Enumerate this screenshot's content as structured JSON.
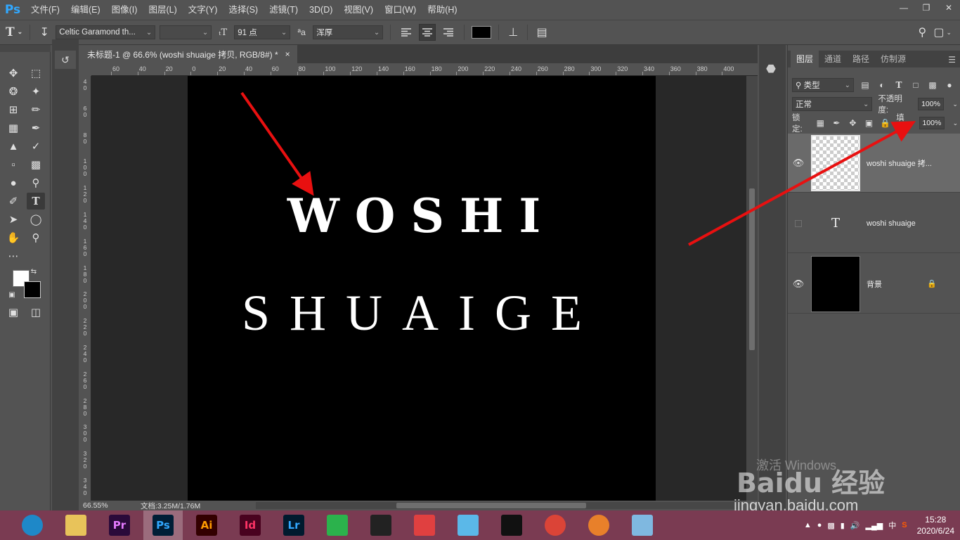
{
  "app": {
    "logo": "Ps"
  },
  "menu": [
    "文件(F)",
    "编辑(E)",
    "图像(I)",
    "图层(L)",
    "文字(Y)",
    "选择(S)",
    "滤镜(T)",
    "3D(D)",
    "视图(V)",
    "窗口(W)",
    "帮助(H)"
  ],
  "options": {
    "font_family": "Celtic Garamond th...",
    "font_style": "",
    "font_size": "91 点",
    "aa_label": "ªa",
    "antialias": "浑厚",
    "text_color": "#000000"
  },
  "document": {
    "tab_title": "未标题-1 @ 66.6% (woshi shuaige  拷贝, RGB/8#) *",
    "close": "×",
    "line1": "WOSHI",
    "line2": "SHUAIGE",
    "ruler_h": [
      "60",
      "40",
      "20",
      "0",
      "20",
      "40",
      "60",
      "80",
      "100",
      "120",
      "140",
      "160",
      "180",
      "200",
      "220",
      "240",
      "260",
      "280",
      "300",
      "320",
      "340",
      "360",
      "380",
      "400"
    ],
    "ruler_v": [
      "4 0",
      "6 0",
      "8 0",
      "1 0 0",
      "1 2 0",
      "1 4 0",
      "1 6 0",
      "1 8 0",
      "2 0 0",
      "2 2 0",
      "2 4 0",
      "2 6 0",
      "2 8 0",
      "3 0 0",
      "3 2 0",
      "3 4 0"
    ]
  },
  "status": {
    "zoom": "66.55%",
    "doc_info": "文档:3.25M/1.76M"
  },
  "layers_panel": {
    "tabs": [
      "图层",
      "通道",
      "路径",
      "仿制源"
    ],
    "filter_type": "类型",
    "blend_mode": "正常",
    "opacity_label": "不透明度:",
    "opacity_value": "100%",
    "lock_label": "锁定:",
    "fill_label": "填充:",
    "fill_value": "100%",
    "layers": [
      {
        "name": "woshi shuaige 拷...",
        "visible": true,
        "kind": "raster-transparent",
        "selected": true
      },
      {
        "name": "woshi shuaige",
        "visible": false,
        "kind": "text",
        "thumb_glyph": "T",
        "selected": false
      },
      {
        "name": "背景",
        "visible": true,
        "kind": "background",
        "locked": true,
        "selected": false
      }
    ]
  },
  "watermark": {
    "activate": "激活 Windows",
    "brand": "Baidu 经验",
    "url": "jingyan.baidu.com"
  },
  "taskbar": {
    "apps": [
      {
        "name": "browser",
        "label": "",
        "bg": "#1e88c8",
        "fg": "#fff"
      },
      {
        "name": "explorer",
        "label": "",
        "bg": "#e8c35a",
        "fg": "#333"
      },
      {
        "name": "premiere",
        "label": "Pr",
        "bg": "#2a0a3a",
        "fg": "#e57bff"
      },
      {
        "name": "photoshop",
        "label": "Ps",
        "bg": "#001e36",
        "fg": "#31a8ff"
      },
      {
        "name": "illustrator",
        "label": "Ai",
        "bg": "#330000",
        "fg": "#ff9a00"
      },
      {
        "name": "indesign",
        "label": "Id",
        "bg": "#49021f",
        "fg": "#ff3366"
      },
      {
        "name": "lightroom",
        "label": "Lr",
        "bg": "#001a2e",
        "fg": "#31a8ff"
      },
      {
        "name": "app-green",
        "label": "",
        "bg": "#2bb24c",
        "fg": "#fff"
      },
      {
        "name": "video-editor",
        "label": "",
        "bg": "#222",
        "fg": "#fff"
      },
      {
        "name": "app-red",
        "label": "",
        "bg": "#e04040",
        "fg": "#fff"
      },
      {
        "name": "app-bird",
        "label": "",
        "bg": "#5bb8e8",
        "fg": "#fff"
      },
      {
        "name": "qq",
        "label": "",
        "bg": "#111",
        "fg": "#ffcc00"
      },
      {
        "name": "chrome",
        "label": "",
        "bg": "#db4437",
        "fg": "#fff"
      },
      {
        "name": "app-orange",
        "label": "",
        "bg": "#e8802a",
        "fg": "#fff"
      },
      {
        "name": "app-note",
        "label": "",
        "bg": "#7fb8e0",
        "fg": "#fff"
      }
    ],
    "ime": "中",
    "time": "15:28",
    "date": "2020/6/24"
  }
}
